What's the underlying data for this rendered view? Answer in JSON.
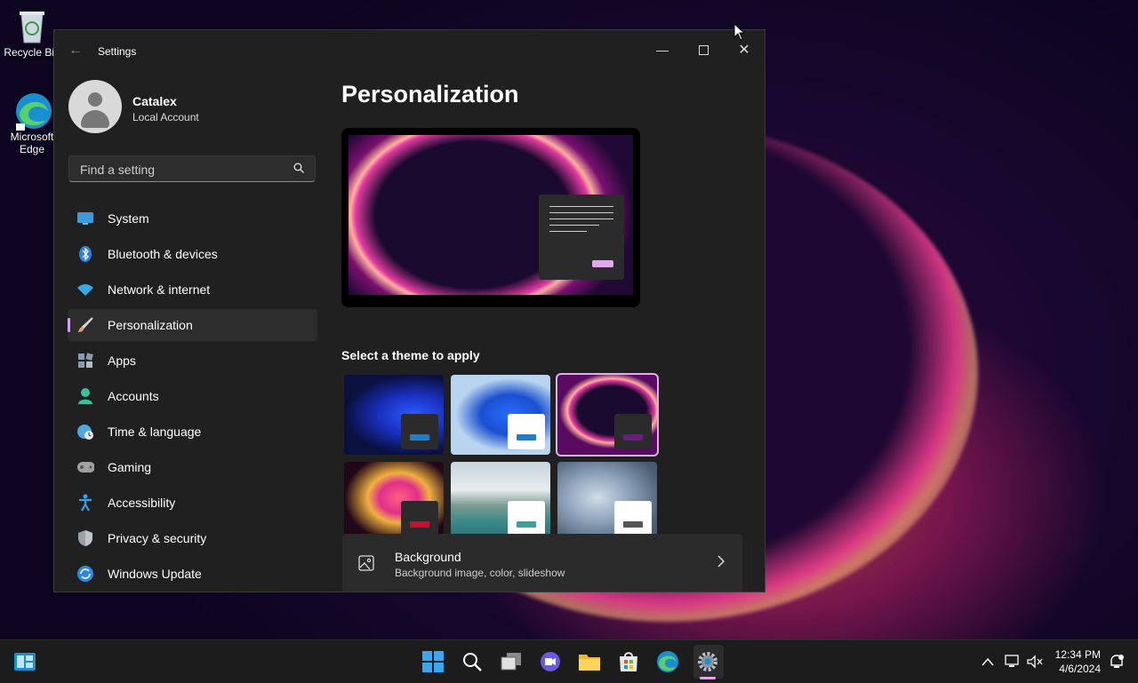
{
  "desktop": {
    "icons": [
      {
        "label": "Recycle Bin"
      },
      {
        "label": "Microsoft Edge"
      }
    ]
  },
  "window": {
    "title": "Settings",
    "back_icon": "back-arrow-icon"
  },
  "account": {
    "name": "Catalex",
    "type": "Local Account"
  },
  "search": {
    "placeholder": "Find a setting"
  },
  "nav": {
    "items": [
      {
        "label": "System",
        "icon": "system-icon",
        "color": "#3a9bd9"
      },
      {
        "label": "Bluetooth & devices",
        "icon": "bluetooth-icon",
        "color": "#2d7fe0"
      },
      {
        "label": "Network & internet",
        "icon": "wifi-icon",
        "color": "#3aa8e8"
      },
      {
        "label": "Personalization",
        "icon": "brush-icon",
        "color": "#e0a070",
        "active": true
      },
      {
        "label": "Apps",
        "icon": "apps-icon",
        "color": "#8a9bb0"
      },
      {
        "label": "Accounts",
        "icon": "accounts-icon",
        "color": "#3cc0a0"
      },
      {
        "label": "Time & language",
        "icon": "globe-clock-icon",
        "color": "#4aa8e0"
      },
      {
        "label": "Gaming",
        "icon": "gamepad-icon",
        "color": "#a0a0a0"
      },
      {
        "label": "Accessibility",
        "icon": "accessibility-icon",
        "color": "#3aa0e8"
      },
      {
        "label": "Privacy & security",
        "icon": "shield-icon",
        "color": "#9aa0a8"
      },
      {
        "label": "Windows Update",
        "icon": "update-icon",
        "color": "#2d8ae0"
      }
    ]
  },
  "content": {
    "page_title": "Personalization",
    "theme_section_label": "Select a theme to apply",
    "themes": [
      {
        "name": "windows-dark",
        "accent": "#1a7fd4",
        "card": "#2b2b2b"
      },
      {
        "name": "windows-light",
        "accent": "#1a7fd4",
        "card": "#ffffff"
      },
      {
        "name": "glow",
        "accent": "#6a1a80",
        "card": "#2b2b2b",
        "selected": true
      },
      {
        "name": "captured-motion",
        "accent": "#c8102e",
        "card": "#2b2b2b"
      },
      {
        "name": "sunrise",
        "accent": "#3aa0a0",
        "card": "#ffffff"
      },
      {
        "name": "flow",
        "accent": "#555555",
        "card": "#ffffff"
      }
    ],
    "background_row": {
      "title": "Background",
      "subtitle": "Background image, color, slideshow"
    }
  },
  "taskbar": {
    "clock_time": "12:34 PM",
    "clock_date": "4/6/2024",
    "accent_color": "#e5a6f0"
  }
}
